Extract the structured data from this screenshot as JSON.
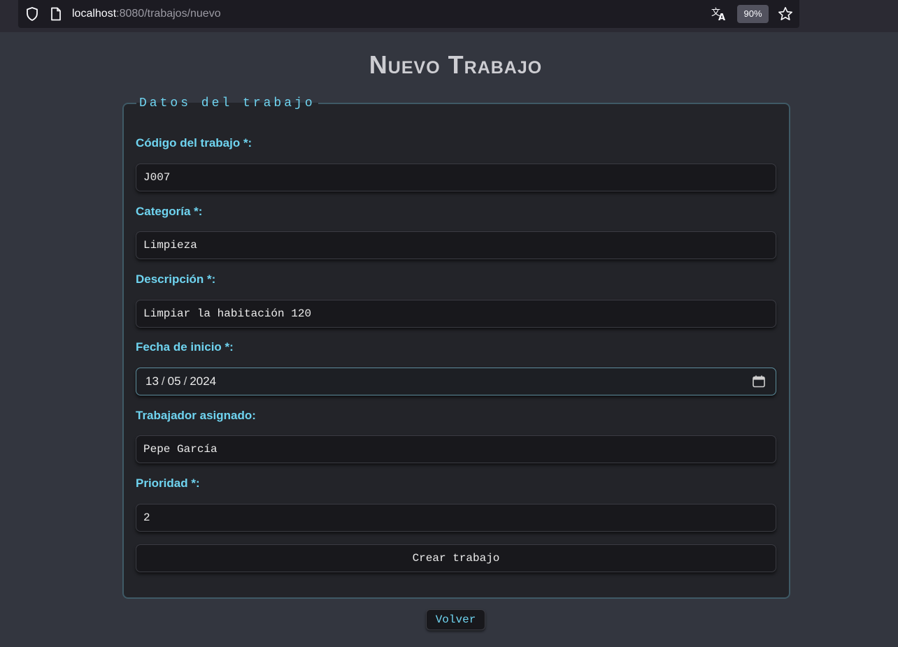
{
  "browser": {
    "url_host": "localhost",
    "url_path": ":8080/trabajos/nuevo",
    "zoom": "90%",
    "icons": [
      "shield-icon",
      "page-icon",
      "translate-icon",
      "star-icon"
    ]
  },
  "page": {
    "title": "Nuevo Trabajo"
  },
  "form": {
    "legend": "Datos del trabajo",
    "fields": {
      "codigo": {
        "label": "Código del trabajo *:",
        "value": "J007"
      },
      "categoria": {
        "label": "Categoría *:",
        "value": "Limpieza"
      },
      "descripcion": {
        "label": "Descripción *:",
        "value": "Limpiar la habitación 120"
      },
      "fecha": {
        "label": "Fecha de inicio *:",
        "day": "13",
        "month": "05",
        "year": "2024",
        "sep": "/"
      },
      "trabajador": {
        "label": "Trabajador asignado:",
        "value": "Pepe García"
      },
      "prioridad": {
        "label": "Prioridad *:",
        "value": "2"
      }
    },
    "submit_label": "Crear trabajo"
  },
  "back_label": "Volver",
  "colors": {
    "background": "#33363f",
    "panel": "#232429",
    "accent": "#6fd4f0",
    "input_bg": "#18181c"
  }
}
